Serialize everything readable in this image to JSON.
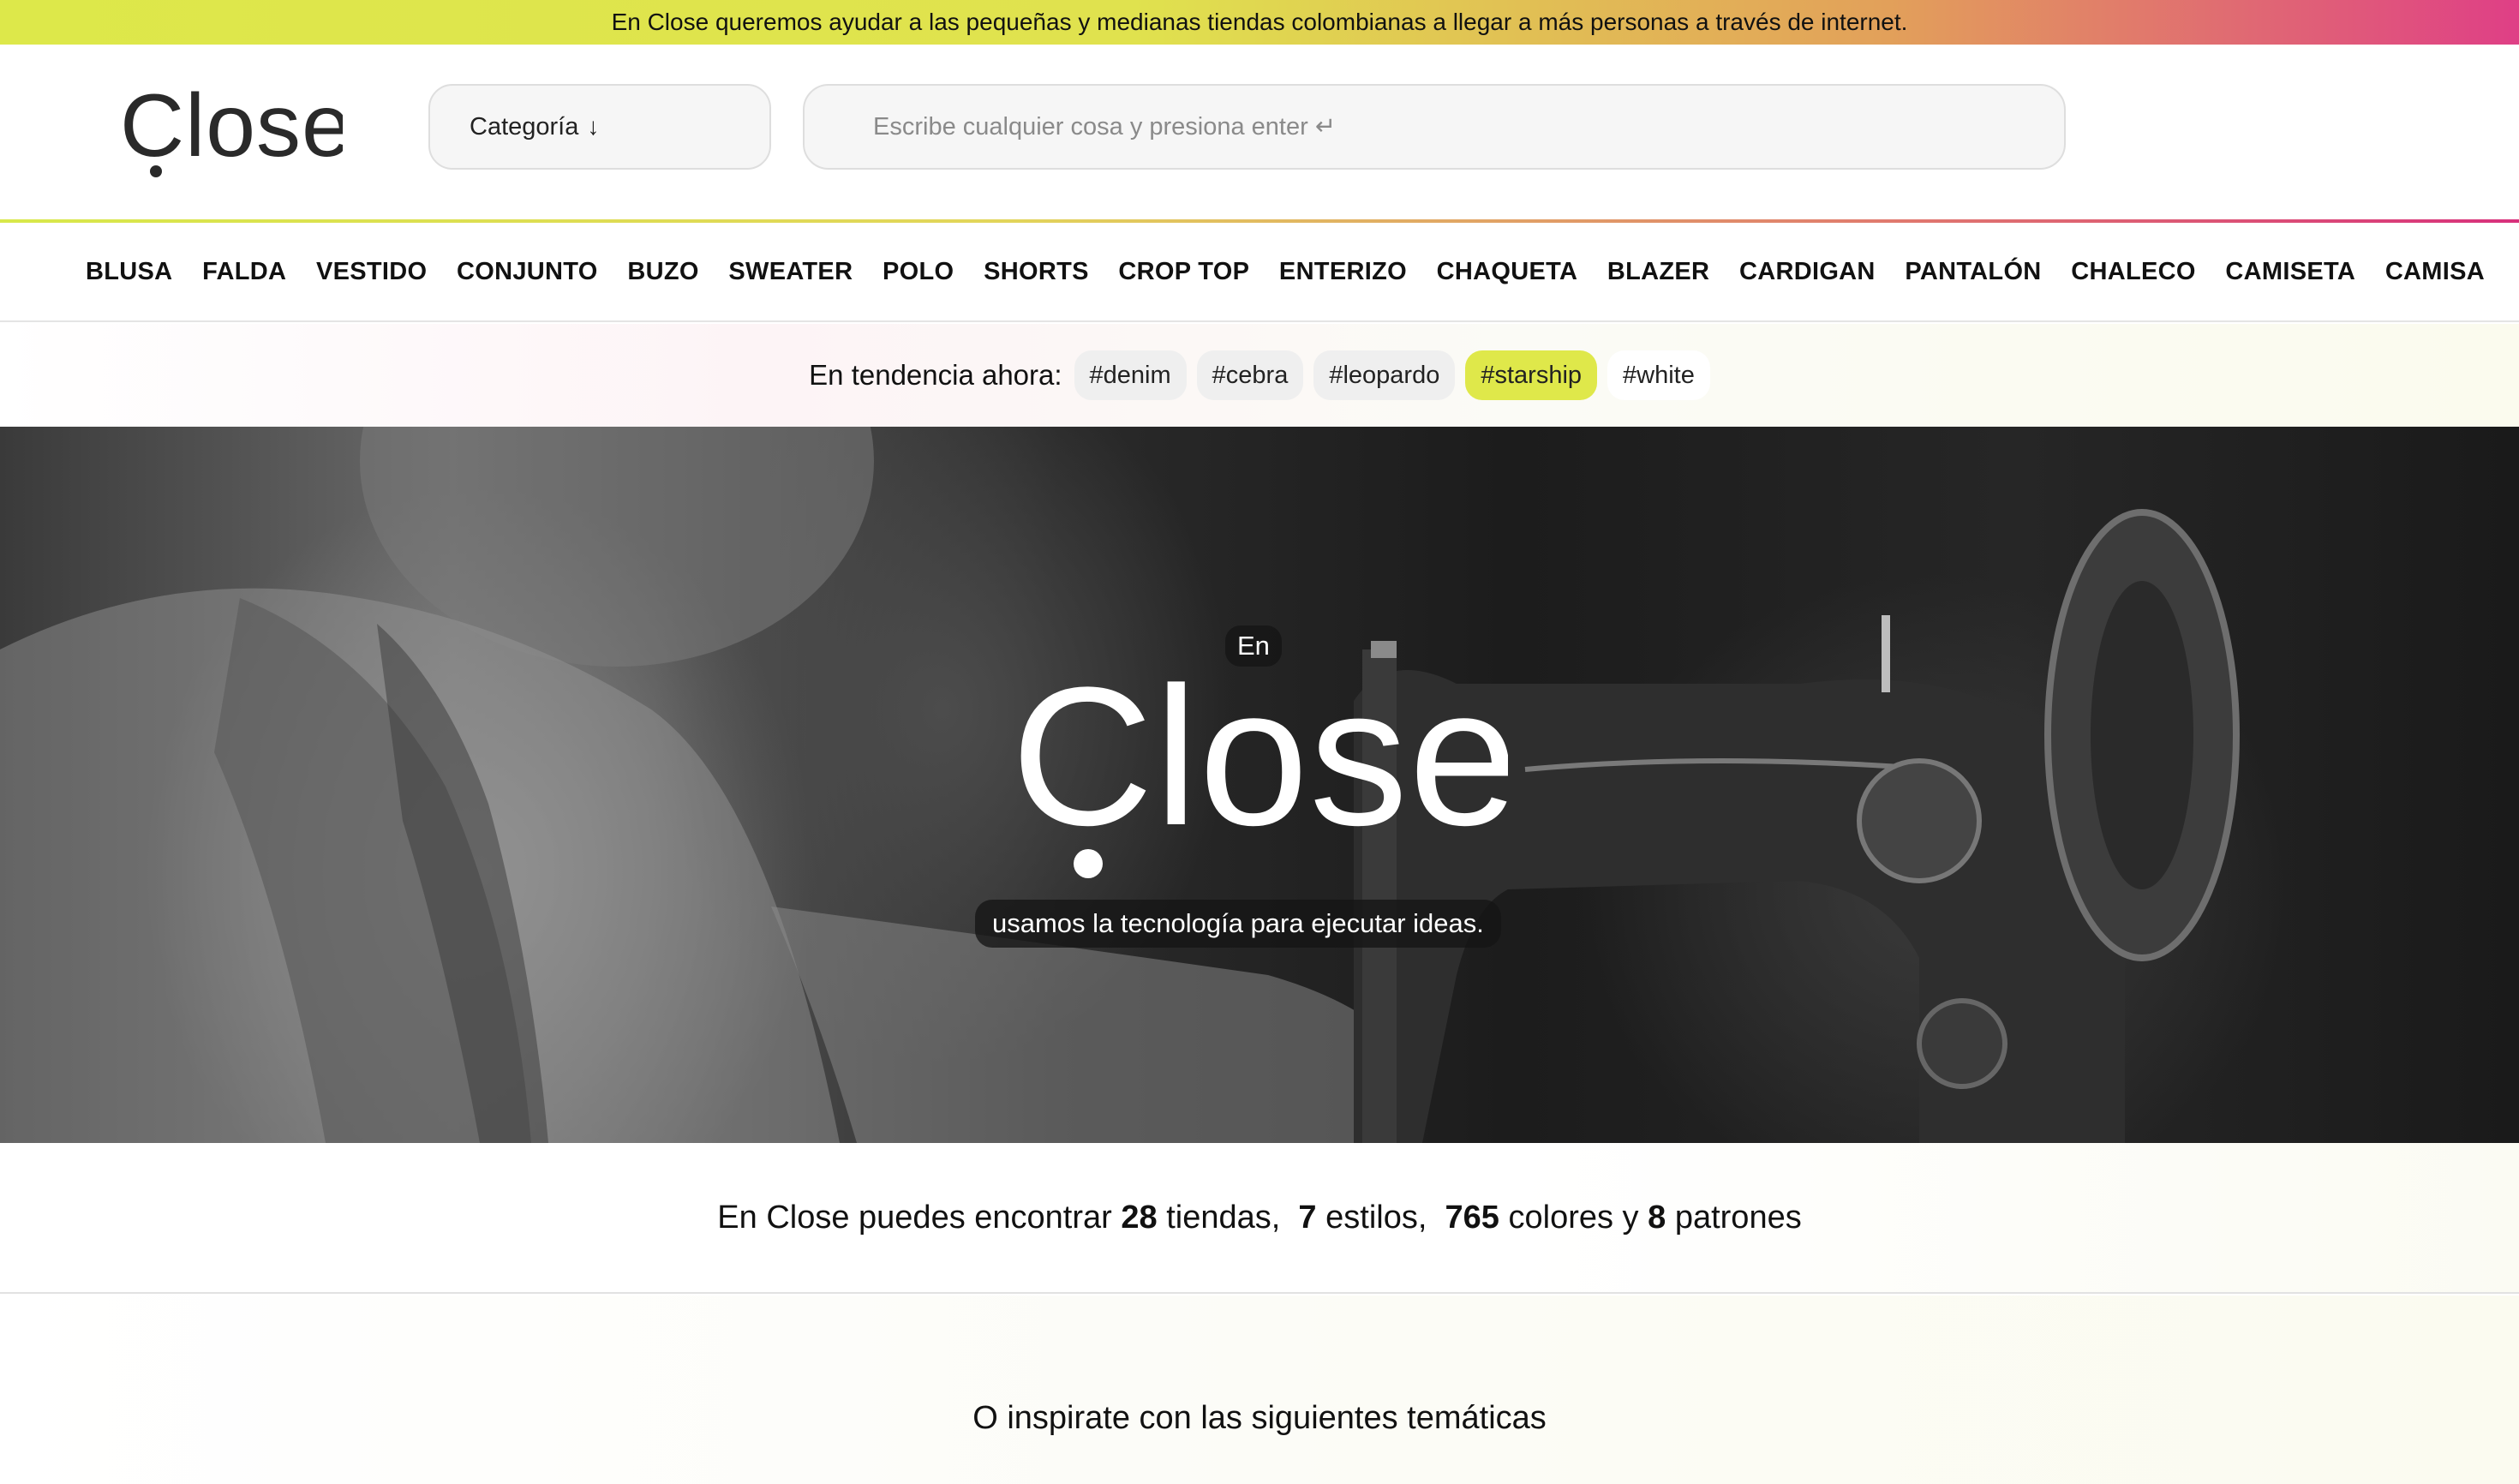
{
  "announcement": "En Close queremos ayudar a las pequeñas y medianas tiendas colombianas a llegar a más personas a través de internet.",
  "brand": {
    "logo_text": "Close"
  },
  "header": {
    "category_button": "Categoría",
    "category_arrow_icon": "arrow-down-icon",
    "search_placeholder": "Escribe cualquier cosa y presiona enter ↵"
  },
  "categories": [
    "BLUSA",
    "FALDA",
    "VESTIDO",
    "CONJUNTO",
    "BUZO",
    "SWEATER",
    "POLO",
    "SHORTS",
    "CROP TOP",
    "ENTERIZO",
    "CHAQUETA",
    "BLAZER",
    "CARDIGAN",
    "PANTALÓN",
    "CHALECO",
    "CAMISETA",
    "CAMISA"
  ],
  "trending": {
    "label": "En tendencia ahora:",
    "tags": [
      "#denim",
      "#cebra",
      "#leopardo",
      "#starship",
      "#white"
    ],
    "active_tag": "#starship"
  },
  "hero": {
    "pre_title": "En",
    "tagline": "usamos la tecnología para ejecutar ideas."
  },
  "stats": {
    "prefix": "En Close puedes encontrar",
    "stores": "28",
    "stores_label": "tiendas,",
    "styles": "7",
    "styles_label": "estilos,",
    "colors": "765",
    "colors_label": "colores y",
    "patterns": "8",
    "patterns_label": "patrones"
  },
  "inspire": {
    "title": "O inspirate con las siguientes temáticas"
  },
  "colors": {
    "accent_lime": "#dfe84a",
    "accent_pink": "#df3f86",
    "text": "#111111"
  }
}
